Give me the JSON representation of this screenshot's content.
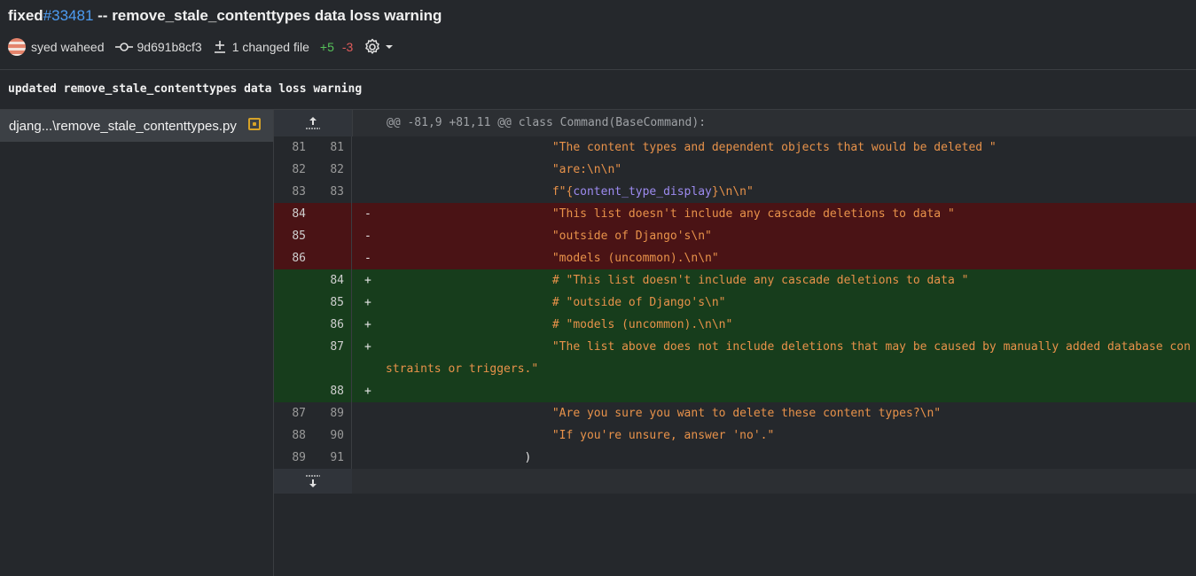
{
  "header": {
    "title_prefix": "fixed",
    "issue_link": "#33481",
    "title_rest": " -- remove_stale_contenttypes data loss warning",
    "author": "syed waheed",
    "commit_hash": "9d691b8cf3",
    "changed_files": "1 changed file",
    "additions": "+5",
    "deletions": "-3"
  },
  "commit_message": "updated remove_stale_contenttypes data loss warning",
  "sidebar": {
    "file_name": "djang...\\remove_stale_contenttypes.py"
  },
  "diff": {
    "hunk_header": "@@ -81,9 +81,11 @@ class Command(BaseCommand):",
    "rows": [
      {
        "type": "ctx",
        "old": "81",
        "new": "81",
        "sign": "",
        "code": "                        \"The content types and dependent objects that would be deleted \""
      },
      {
        "type": "ctx",
        "old": "82",
        "new": "82",
        "sign": "",
        "code": "                        \"are:\\n\\n\""
      },
      {
        "type": "ctx",
        "old": "83",
        "new": "83",
        "sign": "",
        "code_pre": "                        f\"{",
        "code_var": "content_type_display",
        "code_post": "}\\n\\n\""
      },
      {
        "type": "del",
        "old": "84",
        "new": "",
        "sign": "-",
        "code": "                        \"This list doesn't include any cascade deletions to data \""
      },
      {
        "type": "del",
        "old": "85",
        "new": "",
        "sign": "-",
        "code": "                        \"outside of Django's\\n\""
      },
      {
        "type": "del",
        "old": "86",
        "new": "",
        "sign": "-",
        "code": "                        \"models (uncommon).\\n\\n\""
      },
      {
        "type": "add",
        "old": "",
        "new": "84",
        "sign": "+",
        "code": "                        # \"This list doesn't include any cascade deletions to data \""
      },
      {
        "type": "add",
        "old": "",
        "new": "85",
        "sign": "+",
        "code": "                        # \"outside of Django's\\n\""
      },
      {
        "type": "add",
        "old": "",
        "new": "86",
        "sign": "+",
        "code": "                        # \"models (uncommon).\\n\\n\""
      },
      {
        "type": "add",
        "old": "",
        "new": "87",
        "sign": "+",
        "code": "                        \"The list above does not include deletions that may be caused by manually added database constraints or triggers.\""
      },
      {
        "type": "add",
        "old": "",
        "new": "88",
        "sign": "+",
        "code": ""
      },
      {
        "type": "ctx",
        "old": "87",
        "new": "89",
        "sign": "",
        "code": "                        \"Are you sure you want to delete these content types?\\n\""
      },
      {
        "type": "ctx",
        "old": "88",
        "new": "90",
        "sign": "",
        "code": "                        \"If you're unsure, answer 'no'.\""
      },
      {
        "type": "ctx",
        "old": "89",
        "new": "91",
        "sign": "",
        "code": "                    )"
      }
    ]
  }
}
